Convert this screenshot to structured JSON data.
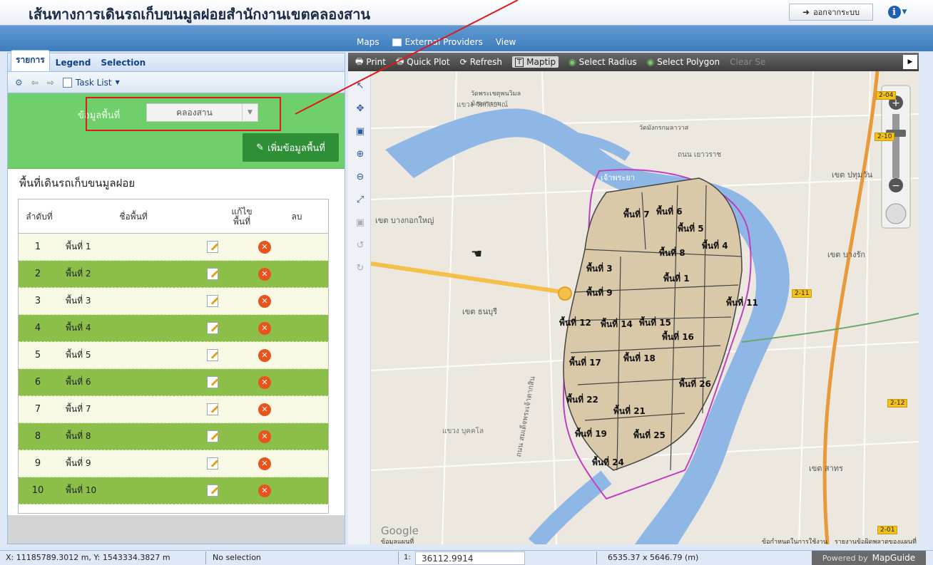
{
  "app": {
    "title": "เส้นทางการเดินรถเก็บขนมูลฝอยสำนักงานเขตคลองสาน",
    "logout_label": "ออกจากระบบ",
    "info_glyph": "i"
  },
  "menubar": {
    "items": [
      "Maps",
      "External Providers",
      "View"
    ]
  },
  "left_panel": {
    "tabs": [
      "รายการ",
      "Legend",
      "Selection"
    ],
    "task_list_label": "Task List",
    "area_field_label": "ข้อมูลพื้นที่",
    "area_select_value": "คลองสาน",
    "add_area_button": "เพิ่มข้อมูลพื้นที่",
    "section_title": "พื้นที่เดินรถเก็บขนมูลฝอย",
    "table": {
      "headers": [
        "ลำดับที่",
        "ชื่อพื้นที่",
        "แก้ไข\nพื้นที่",
        "ลบ"
      ],
      "rows": [
        {
          "num": "1",
          "name": "พื้นที่ 1"
        },
        {
          "num": "2",
          "name": "พื้นที่ 2"
        },
        {
          "num": "3",
          "name": "พื้นที่ 3"
        },
        {
          "num": "4",
          "name": "พื้นที่ 4"
        },
        {
          "num": "5",
          "name": "พื้นที่ 5"
        },
        {
          "num": "6",
          "name": "พื้นที่ 6"
        },
        {
          "num": "7",
          "name": "พื้นที่ 7"
        },
        {
          "num": "8",
          "name": "พื้นที่ 8"
        },
        {
          "num": "9",
          "name": "พื้นที่ 9"
        },
        {
          "num": "10",
          "name": "พื้นที่ 10"
        }
      ]
    }
  },
  "map_toolbar": {
    "print": "Print",
    "quick_plot": "Quick Plot",
    "refresh": "Refresh",
    "maptip": "Maptip",
    "select_radius": "Select Radius",
    "select_polygon": "Select Polygon",
    "clear_selection": "Clear Se"
  },
  "map": {
    "district_labels": [
      {
        "text": "เขต บางกอกใหญ่"
      },
      {
        "text": "เขต ธนบุรี"
      },
      {
        "text": "เขต ปทุมวัน"
      },
      {
        "text": "เขต บางรัก"
      },
      {
        "text": "เขต สาทร"
      },
      {
        "text": "แขวง วัดกัลยาณ์"
      },
      {
        "text": "แขวง บุคคโล"
      },
      {
        "text": "ถนน สมเด็จพระเจ้าตากสิน"
      },
      {
        "text": "เจ้าพระยา"
      },
      {
        "text": "ถนน เยาวราช"
      },
      {
        "text": "วัดพระเชตุพนวิมลมังคลาราม"
      },
      {
        "text": "วัดมังกรกมลาวาส"
      }
    ],
    "zones": [
      "พื้นที่ 1",
      "พื้นที่ 3",
      "พื้นที่ 4",
      "พื้นที่ 5",
      "พื้นที่ 6",
      "พื้นที่ 7",
      "พื้นที่ 8",
      "พื้นที่ 9",
      "พื้นที่ 11",
      "พื้นที่ 12",
      "พื้นที่ 14",
      "พื้นที่ 15",
      "พื้นที่ 16",
      "พื้นที่ 17",
      "พื้นที่ 18",
      "พื้นที่ 19",
      "พื้นที่ 21",
      "พื้นที่ 22",
      "พื้นที่ 24",
      "พื้นที่ 25",
      "พื้นที่ 26"
    ],
    "highway_badges": [
      "2-04",
      "2-10",
      "2-11",
      "2-12",
      "2-01"
    ],
    "google_label": "Google",
    "map_data_label": "ข้อมูลแผนที่",
    "terms_label": "ข้อกำหนดในการใช้งาน",
    "report_label": "รายงานข้อผิดพลาดของแผนที่"
  },
  "status": {
    "coords": "X: 11185789.3012 m, Y: 1543334.3827 m",
    "selection": "No selection",
    "scale_prefix": "1:",
    "scale_value": "36112.9914",
    "size": "6535.37 x 5646.79 (m)",
    "powered_by": "Powered by",
    "brand": "MapGuide"
  },
  "colors": {
    "menubar": "#4a86c5",
    "green_panel": "#6fcf6a",
    "row_green": "#8cbf4a",
    "river": "#8fb7e6",
    "zone_fill": "#d9c9a8",
    "district_border": "#c040c0",
    "annotation": "#e01818"
  }
}
